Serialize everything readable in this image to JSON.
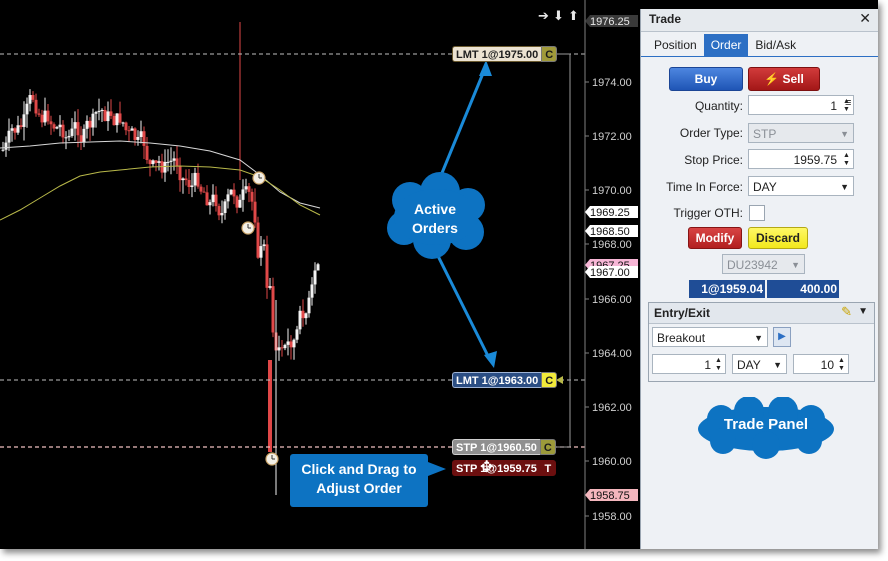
{
  "chart": {
    "price_labels": [
      "1974.00",
      "1972.00",
      "1970.00",
      "1968.00",
      "1966.00",
      "1964.00",
      "1962.00",
      "1960.00",
      "1958.00"
    ],
    "price_tags": [
      {
        "text": "1976.25",
        "bg": "#3a3a3a",
        "fg": "#e8e8e8"
      },
      {
        "text": "1969.25",
        "bg": "#ffffff",
        "fg": "#111111"
      },
      {
        "text": "1968.50",
        "bg": "#ffffff",
        "fg": "#111111"
      },
      {
        "text": "1967.25",
        "bg": "#f7b6d6",
        "fg": "#111111"
      },
      {
        "text": "1967.00",
        "bg": "#ffffff",
        "fg": "#111111"
      },
      {
        "text": "1958.75",
        "bg": "#f4b6bd",
        "fg": "#111111"
      }
    ],
    "nav_arrows": "➔ ⬇ ⬆",
    "orders": {
      "lmt_top": {
        "label": "LMT 1@1975.00",
        "c": "C"
      },
      "lmt_mid": {
        "label": "LMT 1@1963.00",
        "c": "C"
      },
      "stp_active": {
        "label": "STP 1@1960.50",
        "c": "C"
      },
      "stp_drag": {
        "label": "STP 1@1959.75",
        "c": "T"
      }
    },
    "callouts": {
      "active_orders": "Active Orders",
      "click_drag": "Click and Drag to Adjust Order",
      "trade_panel": "Trade Panel"
    }
  },
  "panel": {
    "title": "Trade",
    "close": "✕",
    "tabs": [
      "Position",
      "Order",
      "Bid/Ask"
    ],
    "buy": "Buy",
    "sell": "Sell",
    "quantity_label": "Quantity:",
    "quantity": "1",
    "order_type_label": "Order Type:",
    "order_type": "STP",
    "stop_price_label": "Stop Price:",
    "stop_price": "1959.75",
    "tif_label": "Time In Force:",
    "tif": "DAY",
    "trigger_label": "Trigger OTH:",
    "modify": "Modify",
    "discard": "Discard",
    "account": "DU23942",
    "summary_left": "1@1959.04",
    "summary_right": "400.00",
    "entry_exit": {
      "title": "Entry/Exit",
      "strategy": "Breakout",
      "qty": "1",
      "tif": "DAY",
      "offset": "10"
    }
  }
}
